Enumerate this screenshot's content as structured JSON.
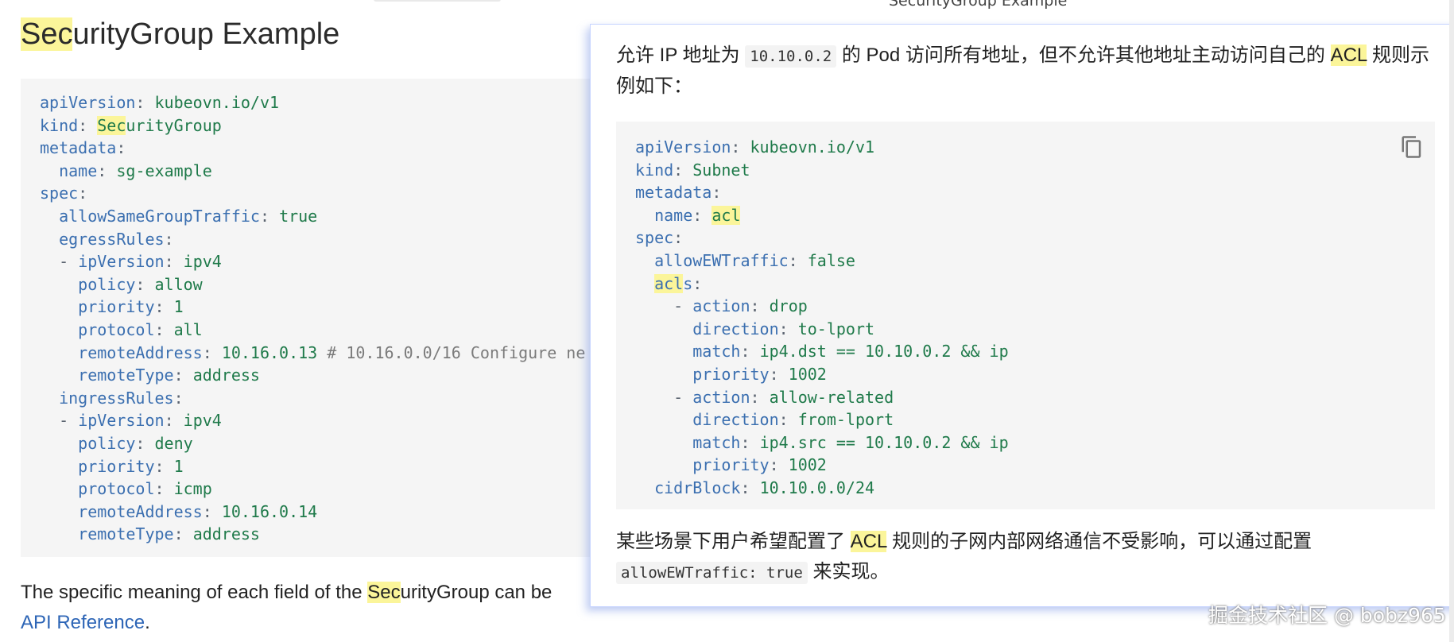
{
  "top_caption": "SecurityGroup Example",
  "page_title": {
    "mark": "Sec",
    "rest": "urityGroup Example"
  },
  "left_code": [
    [
      [
        "k",
        "apiVersion"
      ],
      [
        "p",
        ": "
      ],
      [
        "v",
        "kubeovn.io/v1"
      ]
    ],
    [
      [
        "k",
        "kind"
      ],
      [
        "p",
        ": "
      ],
      [
        "vm",
        "Sec"
      ],
      [
        "v",
        "urityGroup"
      ]
    ],
    [
      [
        "k",
        "metadata"
      ],
      [
        "p",
        ":"
      ]
    ],
    [
      [
        "t",
        "  "
      ],
      [
        "k",
        "name"
      ],
      [
        "p",
        ": "
      ],
      [
        "v",
        "sg-example"
      ]
    ],
    [
      [
        "k",
        "spec"
      ],
      [
        "p",
        ":"
      ]
    ],
    [
      [
        "t",
        "  "
      ],
      [
        "k",
        "allowSameGroupTraffic"
      ],
      [
        "p",
        ": "
      ],
      [
        "v",
        "true"
      ]
    ],
    [
      [
        "t",
        "  "
      ],
      [
        "k",
        "egressRules"
      ],
      [
        "p",
        ":"
      ]
    ],
    [
      [
        "t",
        "  "
      ],
      [
        "p",
        "- "
      ],
      [
        "k",
        "ipVersion"
      ],
      [
        "p",
        ": "
      ],
      [
        "v",
        "ipv4"
      ]
    ],
    [
      [
        "t",
        "    "
      ],
      [
        "k",
        "policy"
      ],
      [
        "p",
        ": "
      ],
      [
        "v",
        "allow"
      ]
    ],
    [
      [
        "t",
        "    "
      ],
      [
        "k",
        "priority"
      ],
      [
        "p",
        ": "
      ],
      [
        "v",
        "1"
      ]
    ],
    [
      [
        "t",
        "    "
      ],
      [
        "k",
        "protocol"
      ],
      [
        "p",
        ": "
      ],
      [
        "v",
        "all"
      ]
    ],
    [
      [
        "t",
        "    "
      ],
      [
        "k",
        "remoteAddress"
      ],
      [
        "p",
        ": "
      ],
      [
        "v",
        "10.16.0.13 "
      ],
      [
        "c",
        "# 10.16.0.0/16 Configure ne"
      ]
    ],
    [
      [
        "t",
        "    "
      ],
      [
        "k",
        "remoteType"
      ],
      [
        "p",
        ": "
      ],
      [
        "v",
        "address"
      ]
    ],
    [
      [
        "t",
        "  "
      ],
      [
        "k",
        "ingressRules"
      ],
      [
        "p",
        ":"
      ]
    ],
    [
      [
        "t",
        "  "
      ],
      [
        "p",
        "- "
      ],
      [
        "k",
        "ipVersion"
      ],
      [
        "p",
        ": "
      ],
      [
        "v",
        "ipv4"
      ]
    ],
    [
      [
        "t",
        "    "
      ],
      [
        "k",
        "policy"
      ],
      [
        "p",
        ": "
      ],
      [
        "v",
        "deny"
      ]
    ],
    [
      [
        "t",
        "    "
      ],
      [
        "k",
        "priority"
      ],
      [
        "p",
        ": "
      ],
      [
        "v",
        "1"
      ]
    ],
    [
      [
        "t",
        "    "
      ],
      [
        "k",
        "protocol"
      ],
      [
        "p",
        ": "
      ],
      [
        "v",
        "icmp"
      ]
    ],
    [
      [
        "t",
        "    "
      ],
      [
        "k",
        "remoteAddress"
      ],
      [
        "p",
        ": "
      ],
      [
        "v",
        "10.16.0.14"
      ]
    ],
    [
      [
        "t",
        "    "
      ],
      [
        "k",
        "remoteType"
      ],
      [
        "p",
        ": "
      ],
      [
        "v",
        "address"
      ]
    ]
  ],
  "left_paragraph": {
    "before": "The specific meaning of each field of the ",
    "mark": "Sec",
    "after": "urityGroup can be",
    "link": "API Reference",
    "period": "."
  },
  "popup": {
    "text1": {
      "a": "允许 IP 地址为 ",
      "code": "10.10.0.2",
      "b": " 的 Pod 访问所有地址，但不允许其他地址主动访问自己的 ",
      "mark": "ACL",
      "c": " 规则示例如下："
    },
    "code": [
      [
        [
          "k",
          "apiVersion"
        ],
        [
          "p",
          ": "
        ],
        [
          "v",
          "kubeovn.io/v1"
        ]
      ],
      [
        [
          "k",
          "kind"
        ],
        [
          "p",
          ": "
        ],
        [
          "v",
          "Subnet"
        ]
      ],
      [
        [
          "k",
          "metadata"
        ],
        [
          "p",
          ":"
        ]
      ],
      [
        [
          "t",
          "  "
        ],
        [
          "k",
          "name"
        ],
        [
          "p",
          ": "
        ],
        [
          "vm",
          "acl"
        ]
      ],
      [
        [
          "k",
          "spec"
        ],
        [
          "p",
          ":"
        ]
      ],
      [
        [
          "t",
          "  "
        ],
        [
          "k",
          "allowEWTraffic"
        ],
        [
          "p",
          ": "
        ],
        [
          "v",
          "false"
        ]
      ],
      [
        [
          "t",
          "  "
        ],
        [
          "km",
          "acl"
        ],
        [
          "k",
          "s"
        ],
        [
          "p",
          ":"
        ]
      ],
      [
        [
          "t",
          "    "
        ],
        [
          "p",
          "- "
        ],
        [
          "k",
          "action"
        ],
        [
          "p",
          ": "
        ],
        [
          "v",
          "drop"
        ]
      ],
      [
        [
          "t",
          "      "
        ],
        [
          "k",
          "direction"
        ],
        [
          "p",
          ": "
        ],
        [
          "v",
          "to-lport"
        ]
      ],
      [
        [
          "t",
          "      "
        ],
        [
          "k",
          "match"
        ],
        [
          "p",
          ": "
        ],
        [
          "v",
          "ip4.dst == 10.10.0.2 && ip"
        ]
      ],
      [
        [
          "t",
          "      "
        ],
        [
          "k",
          "priority"
        ],
        [
          "p",
          ": "
        ],
        [
          "v",
          "1002"
        ]
      ],
      [
        [
          "t",
          "    "
        ],
        [
          "p",
          "- "
        ],
        [
          "k",
          "action"
        ],
        [
          "p",
          ": "
        ],
        [
          "v",
          "allow-related"
        ]
      ],
      [
        [
          "t",
          "      "
        ],
        [
          "k",
          "direction"
        ],
        [
          "p",
          ": "
        ],
        [
          "v",
          "from-lport"
        ]
      ],
      [
        [
          "t",
          "      "
        ],
        [
          "k",
          "match"
        ],
        [
          "p",
          ": "
        ],
        [
          "v",
          "ip4.src == 10.10.0.2 && ip"
        ]
      ],
      [
        [
          "t",
          "      "
        ],
        [
          "k",
          "priority"
        ],
        [
          "p",
          ": "
        ],
        [
          "v",
          "1002"
        ]
      ],
      [
        [
          "t",
          "  "
        ],
        [
          "k",
          "cidrBlock"
        ],
        [
          "p",
          ": "
        ],
        [
          "v",
          "10.10.0.0/24"
        ]
      ]
    ],
    "text2": {
      "a": "某些场景下用户希望配置了 ",
      "mark": "ACL",
      "b": " 规则的子网内部网络通信不受影响，可以通过配置",
      "code": "allowEWTraffic: true",
      "c": " 来实现。"
    },
    "copy_icon": "copy-icon"
  },
  "watermark": "掘金技术社区 @ bobz965",
  "colors": {
    "highlight": "#fbf59a",
    "key": "#3b6fb0",
    "value": "#1f7a4a",
    "link": "#2d65b6",
    "popup_border": "#c9d6ff"
  }
}
